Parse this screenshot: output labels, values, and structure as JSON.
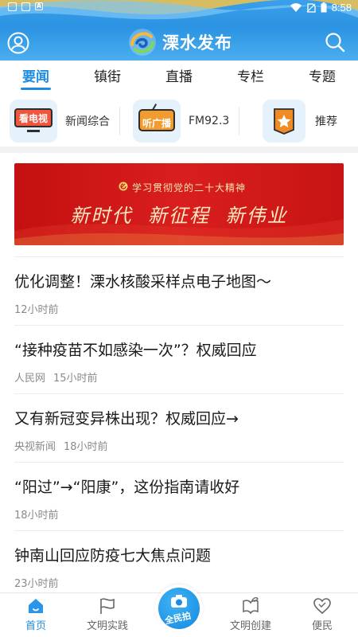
{
  "status_bar": {
    "time": "8:58"
  },
  "header": {
    "app_title": "溧水发布",
    "icons": {
      "left": "user-icon",
      "right": "search-icon"
    }
  },
  "tabs": [
    {
      "label": "要闻",
      "active": true
    },
    {
      "label": "镇街",
      "active": false
    },
    {
      "label": "直播",
      "active": false
    },
    {
      "label": "专栏",
      "active": false
    },
    {
      "label": "专题",
      "active": false
    }
  ],
  "quick_links": [
    {
      "badge": "看电视",
      "label": "新闻综合",
      "icon": "tv-icon"
    },
    {
      "badge": "听广播",
      "label": "FM92.3",
      "icon": "radio-icon"
    },
    {
      "badge": "",
      "label": "推荐",
      "icon": "star-ribbon-icon"
    }
  ],
  "banner": {
    "subtitle": "学习贯彻党的二十大精神",
    "main": "新时代 新征程 新伟业"
  },
  "news": [
    {
      "title": "优化调整！溧水核酸采样点电子地图～",
      "source": "",
      "time": "12小时前"
    },
    {
      "title": "“接种疫苗不如感染一次”？权威回应",
      "source": "人民网",
      "time": "15小时前"
    },
    {
      "title": "又有新冠变异株出现？权威回应→",
      "source": "央视新闻",
      "time": "18小时前"
    },
    {
      "title": "“阳过”→“阳康”，这份指南请收好",
      "source": "",
      "time": "18小时前"
    },
    {
      "title": "钟南山回应防疫七大焦点问题",
      "source": "",
      "time": "23小时前"
    }
  ],
  "bottom_nav": [
    {
      "label": "首页",
      "icon": "home-icon",
      "active": true
    },
    {
      "label": "文明实践",
      "icon": "flag-icon",
      "active": false
    },
    {
      "label": "全民拍",
      "icon": "camera-icon",
      "active": false
    },
    {
      "label": "文明创建",
      "icon": "leaf-book-icon",
      "active": false
    },
    {
      "label": "便民",
      "icon": "heart-icon",
      "active": false
    }
  ],
  "colors": {
    "accent": "#1d8de4",
    "header": "#2b93e2",
    "banner": "#c41010"
  }
}
